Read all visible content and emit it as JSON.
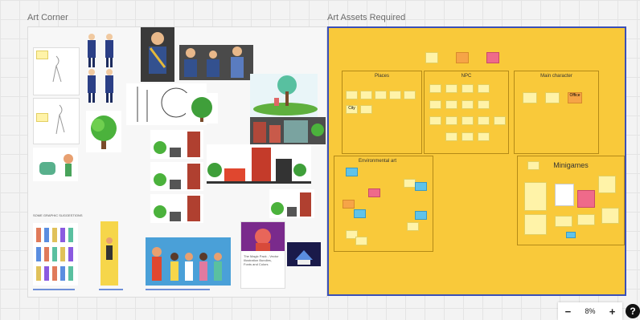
{
  "left_frame": {
    "title": "Art Corner",
    "section_label": "SOME GRAPHIC SUGGESTIONS",
    "article": {
      "title": "The Magic Pack - Vector Illustration Bundles, Fonts and Colors"
    }
  },
  "right_frame": {
    "title": "Art Assets Required",
    "sections": {
      "places": "Places",
      "npc": "NPC",
      "main_character": "Main character",
      "environmental_art": "Environmental art",
      "minigames": "Minigames"
    },
    "sticky_labels": {
      "city": "City",
      "office": "Office"
    }
  },
  "zoom": {
    "minus": "−",
    "level": "8%",
    "plus": "+",
    "help": "?"
  },
  "colors": {
    "frame_fill": "#f9c93a",
    "frame_border": "#3a4fb8",
    "sticky_yellow": "#fff3a8",
    "sticky_orange": "#f6a447",
    "sticky_pink": "#ef6a8a",
    "sticky_blue": "#5fc3ea"
  }
}
